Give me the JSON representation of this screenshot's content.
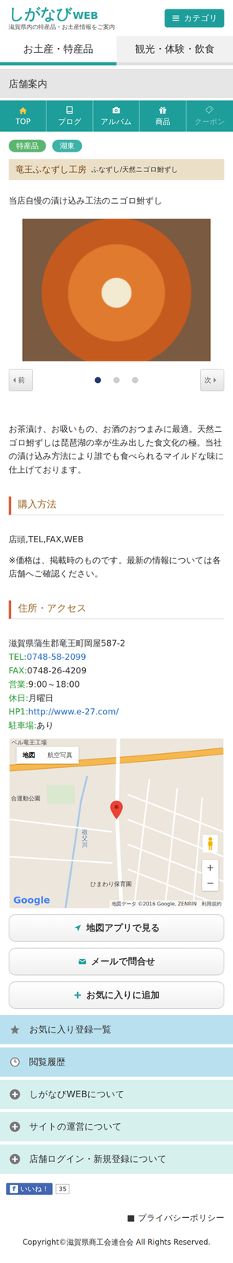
{
  "header": {
    "logo_main": "しがなび",
    "logo_sub": "WEB",
    "tagline": "滋賀県内の特産品・お土産情報をご案内",
    "category_button": "カテゴリ"
  },
  "tabs": [
    {
      "label": "お土産・特産品",
      "selected": true
    },
    {
      "label": "観光・体験・飲食",
      "selected": false
    }
  ],
  "section_title": "店舗案内",
  "nav": [
    {
      "label": "TOP",
      "disabled": false
    },
    {
      "label": "ブログ",
      "disabled": false
    },
    {
      "label": "アルバム",
      "disabled": false
    },
    {
      "label": "商品",
      "disabled": false
    },
    {
      "label": "クーポン",
      "disabled": true
    }
  ],
  "tags": [
    {
      "label": "特産品",
      "color": "#5bb56f"
    },
    {
      "label": "湖東",
      "color": "#3db2a6"
    }
  ],
  "shop": {
    "name": "竜王ふなずし工房",
    "category": "ふなずし/天然ニゴロ鮒ずし",
    "catch": "当店自慢の漬け込み工法のニゴロ鮒ずし"
  },
  "slider": {
    "prev": "前",
    "next": "次",
    "dots": [
      {
        "selected": true
      },
      {
        "selected": false
      },
      {
        "selected": false
      }
    ]
  },
  "description": "お茶漬け、お吸いもの、お酒のおつまみに最適。天然ニゴロ鮒ずしは琵琶湖の幸が生み出した食文化の極。当社の漬け込み方法により誰でも食べられるマイルドな味に仕上げております。",
  "purchase": {
    "heading": "購入方法",
    "methods": "店頭,TEL,FAX,WEB",
    "note": "※価格は、掲載時のものです。最新の情報については各店舗へご確認ください。"
  },
  "access": {
    "heading": "住所・アクセス",
    "lines": [
      {
        "label": "",
        "value": "滋賀県蒲生郡竜王町岡屋587-2",
        "kind": "text"
      },
      {
        "label": "TEL:",
        "value": "0748-58-2099",
        "kind": "link"
      },
      {
        "label": "FAX:",
        "value": "0748-26-4209",
        "kind": "text"
      },
      {
        "label": "営業:",
        "value": "9:00～18:00",
        "kind": "text"
      },
      {
        "label": "休日:",
        "value": "月曜日",
        "kind": "text"
      },
      {
        "label": "HP1:",
        "value": "http://www.e-27.com/",
        "kind": "link"
      },
      {
        "label": "駐車場:",
        "value": "あり",
        "kind": "text"
      }
    ]
  },
  "map": {
    "type_buttons": [
      {
        "label": "地図",
        "selected": true
      },
      {
        "label": "航空写真",
        "selected": false
      }
    ],
    "labels": [
      "ベル竜王工場",
      "合運動公園",
      "ひまわり保育園"
    ],
    "river": "祖父川",
    "zoom_in": "+",
    "zoom_out": "−",
    "logo": "Google",
    "attribution": "地図データ ©2016 Google, ZENRIN",
    "terms": "利用規約"
  },
  "buttons": [
    {
      "label": "地図アプリで見る"
    },
    {
      "label": "メールで問合せ"
    },
    {
      "label": "お気に入りに追加"
    }
  ],
  "menu": [
    {
      "label": "お気に入り登録一覧",
      "kind": "primary"
    },
    {
      "label": "閲覧履歴",
      "kind": "primary"
    },
    {
      "label": "しがなびWEBについて",
      "kind": "info"
    },
    {
      "label": "サイトの運営について",
      "kind": "info"
    },
    {
      "label": "店舗ログイン・新規登録について",
      "kind": "info"
    }
  ],
  "facebook": {
    "logo": "f",
    "label": "いいね！",
    "count": "35"
  },
  "footer": {
    "privacy_mark": "■",
    "privacy": "プライバシーポリシー",
    "copyright": "Copyright©滋賀県商工会連合会 All Rights Reserved."
  }
}
